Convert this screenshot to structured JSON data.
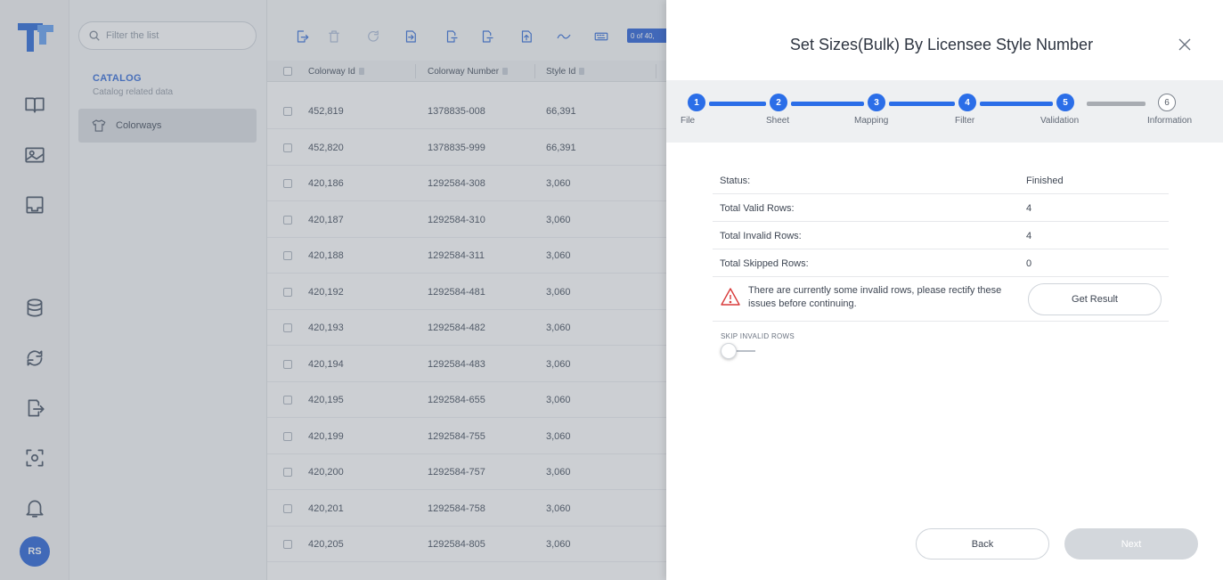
{
  "sidebar": {
    "rail_icons": [
      "book-icon",
      "image-upload-icon",
      "inbox-icon",
      "database-icon",
      "sync-icon",
      "export-icon",
      "scan-icon",
      "bell-icon"
    ],
    "avatar_initials": "RS"
  },
  "nav": {
    "filter_placeholder": "Filter the list",
    "category_title": "CATALOG",
    "category_subtitle": "Catalog related data",
    "items": [
      {
        "label": "Colorways"
      }
    ]
  },
  "grid": {
    "count_badge": "0 of 40,",
    "columns": [
      "Colorway Id",
      "Colorway Number",
      "Style Id"
    ],
    "rows": [
      [
        "452,819",
        "1378835-008",
        "66,391"
      ],
      [
        "452,820",
        "1378835-999",
        "66,391"
      ],
      [
        "420,186",
        "1292584-308",
        "3,060"
      ],
      [
        "420,187",
        "1292584-310",
        "3,060"
      ],
      [
        "420,188",
        "1292584-311",
        "3,060"
      ],
      [
        "420,192",
        "1292584-481",
        "3,060"
      ],
      [
        "420,193",
        "1292584-482",
        "3,060"
      ],
      [
        "420,194",
        "1292584-483",
        "3,060"
      ],
      [
        "420,195",
        "1292584-655",
        "3,060"
      ],
      [
        "420,199",
        "1292584-755",
        "3,060"
      ],
      [
        "420,200",
        "1292584-757",
        "3,060"
      ],
      [
        "420,201",
        "1292584-758",
        "3,060"
      ],
      [
        "420,205",
        "1292584-805",
        "3,060"
      ]
    ]
  },
  "dialog": {
    "title": "Set Sizes(Bulk) By Licensee Style Number",
    "steps": [
      {
        "number": "1",
        "label": "File",
        "state": "done"
      },
      {
        "number": "2",
        "label": "Sheet",
        "state": "done"
      },
      {
        "number": "3",
        "label": "Mapping",
        "state": "done"
      },
      {
        "number": "4",
        "label": "Filter",
        "state": "done"
      },
      {
        "number": "5",
        "label": "Validation",
        "state": "done"
      },
      {
        "number": "6",
        "label": "Information",
        "state": "pending"
      }
    ],
    "status": [
      {
        "key": "Status:",
        "value": "Finished"
      },
      {
        "key": "Total Valid Rows:",
        "value": "4"
      },
      {
        "key": "Total Invalid Rows:",
        "value": "4"
      },
      {
        "key": "Total Skipped Rows:",
        "value": "0"
      }
    ],
    "warning_text": "There are currently some invalid rows, please rectify these issues before continuing.",
    "get_result_label": "Get Result",
    "skip_invalid_label": "SKIP INVALID ROWS",
    "skip_invalid_enabled": false,
    "back_label": "Back",
    "next_label": "Next"
  },
  "colors": {
    "accent": "#2b6ee8",
    "brand": "#1e5bd3",
    "warning": "#d83a3a",
    "step_pending": "#a8acb2"
  }
}
